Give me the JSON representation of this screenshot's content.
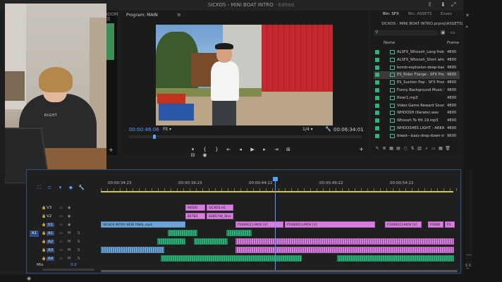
{
  "window": {
    "title": "SICKOS - MINI BOAT INTRO",
    "title_suffix": "- Edited"
  },
  "webcam": {
    "hoodie_print": "RIGHT"
  },
  "left_panel": {
    "tab_label": "IDOM ☰",
    "add_icon": "plus-icon"
  },
  "program_monitor": {
    "tab_label": "Program: MAIN",
    "menu_icon": "≡",
    "timecode_current": "00:00:46:06",
    "fit_label": "Fit",
    "ratio_label": "1/4",
    "timecode_duration": "00:06:34:01",
    "transport": [
      "▾",
      "{",
      "}",
      "⇤",
      "◂",
      "▶",
      "▸",
      "⇥",
      "⊞",
      "⊟",
      "◉"
    ]
  },
  "bin": {
    "tabs": [
      {
        "label": "Bin: SFX",
        "active": true
      },
      {
        "label": "Bin: ASSETS",
        "active": false
      },
      {
        "label": "Essen",
        "active": false
      }
    ],
    "path": "SICKOS - MINI BOAT INTRO.prproj\\ASSETS\\SFX",
    "col_name": "Name",
    "col_rate": "Frame",
    "items": [
      {
        "name": "ALSFX_Whoosh_Long frobo",
        "rate": "4800",
        "selected": false
      },
      {
        "name": "ALSFX_Whoosh_Short who",
        "rate": "4800",
        "selected": false
      },
      {
        "name": "bomb-explosion-deep-bass-",
        "rate": "4800",
        "selected": false
      },
      {
        "name": "ES_Rider Flange - SFX Produ",
        "rate": "4800",
        "selected": true
      },
      {
        "name": "ES_Suction Pop - SFX Produ",
        "rate": "4800",
        "selected": false
      },
      {
        "name": "Funny Background Music N",
        "rate": "4800",
        "selected": false
      },
      {
        "name": "Riser1.mp3",
        "rate": "4800",
        "selected": false
      },
      {
        "name": "Video Game Reward Sound",
        "rate": "4800",
        "selected": false
      },
      {
        "name": "WHOOSH (Karate).wav",
        "rate": "4800",
        "selected": false
      },
      {
        "name": "Whoosh To Hit 19.mp3",
        "rate": "4800",
        "selected": false
      },
      {
        "name": "WHOOSHES LIGHT - ARKAN",
        "rate": "4800",
        "selected": false
      },
      {
        "name": "bleed---bass-drop-down-trai",
        "rate": "9600",
        "selected": false
      }
    ]
  },
  "timeline": {
    "ruler_labels": [
      "00:00:34:23",
      "00:00:39:23",
      "00:00:44:22",
      "00:00:49:22",
      "00:00:54:22"
    ],
    "tracks": [
      {
        "label": "V3",
        "src": ""
      },
      {
        "label": "V2",
        "src": ""
      },
      {
        "label": "V1",
        "src": "V1"
      },
      {
        "label": "A1",
        "src": "A1"
      },
      {
        "label": "A2",
        "src": ""
      },
      {
        "label": "A3",
        "src": ""
      },
      {
        "label": "A4",
        "src": ""
      }
    ],
    "clips": {
      "v3a": "MODO",
      "v3b": "SICKOS H1",
      "v2a": "82783",
      "v2b": "8285744_Stoc",
      "v1a": "SICKOS INTRO NEW FINAL.mp4",
      "v1b": "P1000013.MOV [V]",
      "v1c": "P1000013.MOV [V]",
      "v1d": "P1000013.MOV [V]",
      "v1e": "P1000",
      "v1f": "P1"
    },
    "mix_label": "Mix",
    "mix_value": "0.0"
  },
  "colors": {
    "accent": "#4fa3ff",
    "clip_video": "#d77fdc",
    "clip_audio_green": "#2fae78",
    "clip_blue": "#6ea4d6"
  }
}
